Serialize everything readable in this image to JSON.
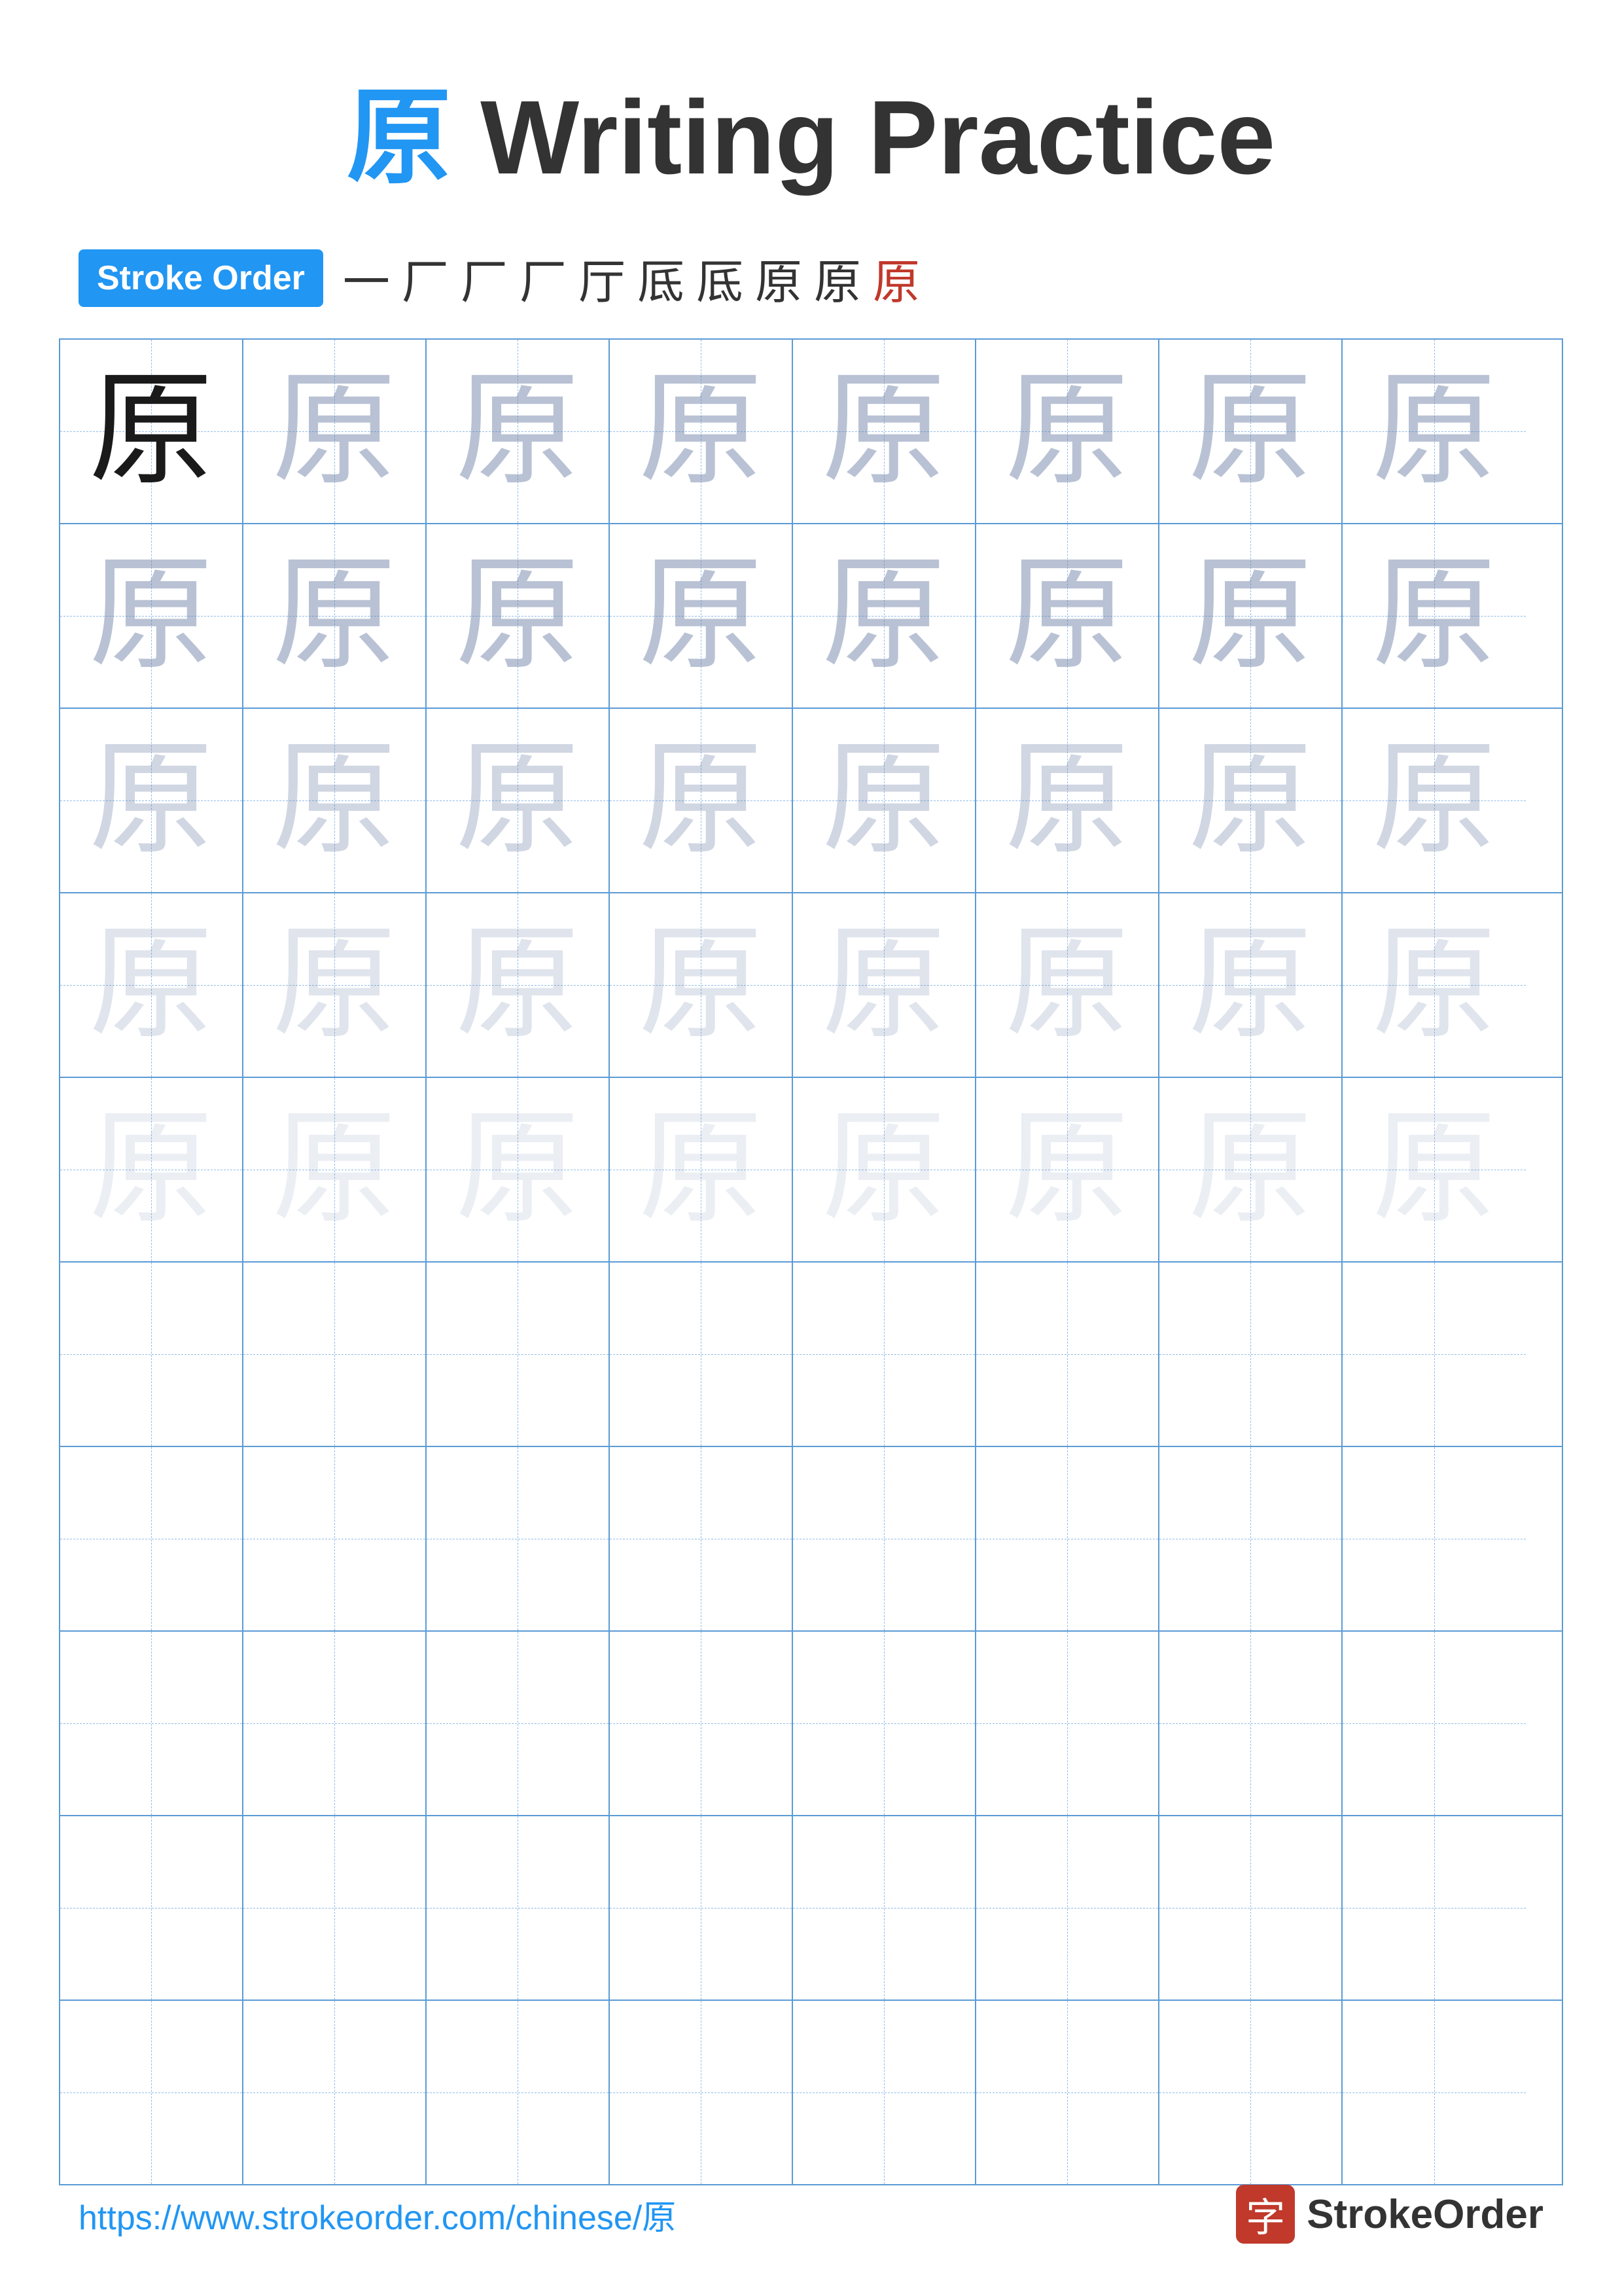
{
  "page": {
    "title_char": "原",
    "title_rest": " Writing Practice",
    "stroke_order_label": "Stroke Order",
    "stroke_steps": [
      "一",
      "厂",
      "厂",
      "厂",
      "厅",
      "厎",
      "厎",
      "原",
      "原",
      "原"
    ],
    "character": "原",
    "footer_url": "https://www.strokeorder.com/chinese/原",
    "footer_logo_char": "字",
    "footer_logo_text": "StrokeOrder"
  },
  "grid": {
    "rows": 10,
    "cols": 8,
    "practice_rows": [
      [
        "solid",
        "ghost-1",
        "ghost-1",
        "ghost-1",
        "ghost-1",
        "ghost-1",
        "ghost-1",
        "ghost-1"
      ],
      [
        "ghost-1",
        "ghost-1",
        "ghost-1",
        "ghost-1",
        "ghost-1",
        "ghost-1",
        "ghost-1",
        "ghost-1"
      ],
      [
        "ghost-2",
        "ghost-2",
        "ghost-2",
        "ghost-2",
        "ghost-2",
        "ghost-2",
        "ghost-2",
        "ghost-2"
      ],
      [
        "ghost-3",
        "ghost-3",
        "ghost-3",
        "ghost-3",
        "ghost-3",
        "ghost-3",
        "ghost-3",
        "ghost-3"
      ],
      [
        "ghost-4",
        "ghost-4",
        "ghost-4",
        "ghost-4",
        "ghost-4",
        "ghost-4",
        "ghost-4",
        "ghost-4"
      ],
      [
        "empty",
        "empty",
        "empty",
        "empty",
        "empty",
        "empty",
        "empty",
        "empty"
      ],
      [
        "empty",
        "empty",
        "empty",
        "empty",
        "empty",
        "empty",
        "empty",
        "empty"
      ],
      [
        "empty",
        "empty",
        "empty",
        "empty",
        "empty",
        "empty",
        "empty",
        "empty"
      ],
      [
        "empty",
        "empty",
        "empty",
        "empty",
        "empty",
        "empty",
        "empty",
        "empty"
      ],
      [
        "empty",
        "empty",
        "empty",
        "empty",
        "empty",
        "empty",
        "empty",
        "empty"
      ]
    ]
  }
}
